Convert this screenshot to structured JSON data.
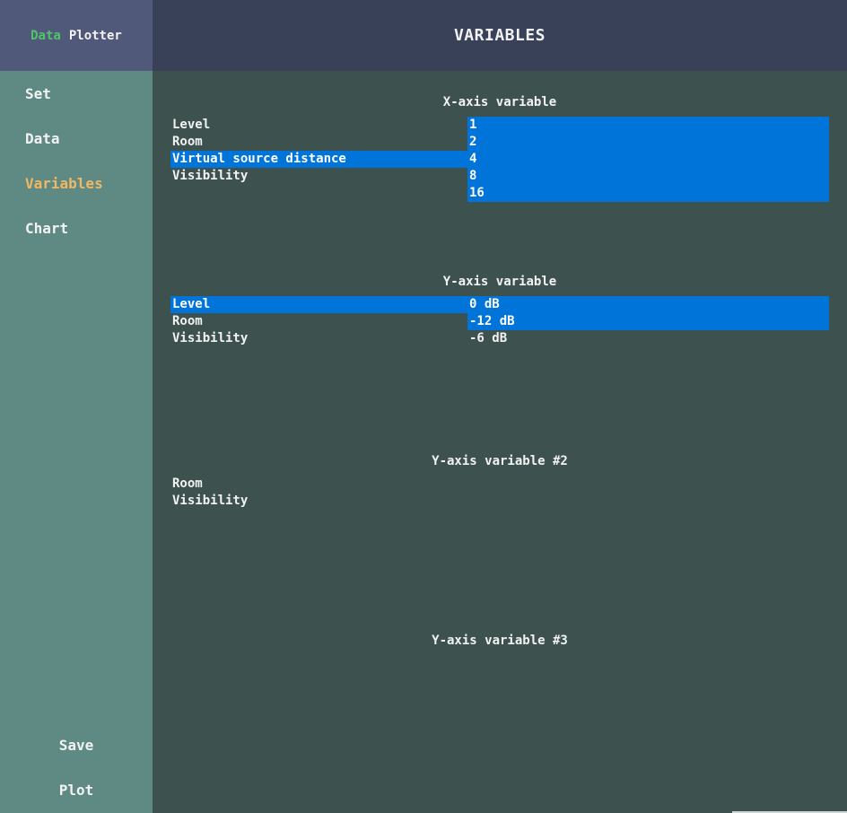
{
  "app": {
    "logo_word1": "Data",
    "logo_word2": "Plotter",
    "header_title": "VARIABLES"
  },
  "sidebar": {
    "items": [
      {
        "label": "Set",
        "active": false
      },
      {
        "label": "Data",
        "active": false
      },
      {
        "label": "Variables",
        "active": true
      },
      {
        "label": "Chart",
        "active": false
      }
    ],
    "save_label": "Save",
    "plot_label": "Plot"
  },
  "x_axis": {
    "title": "X-axis variable",
    "variables": [
      {
        "label": "Level",
        "selected": false
      },
      {
        "label": "Room",
        "selected": false
      },
      {
        "label": "Virtual source distance",
        "selected": true
      },
      {
        "label": "Visibility",
        "selected": false
      }
    ],
    "values": [
      {
        "label": "1",
        "selected": true
      },
      {
        "label": "2",
        "selected": true
      },
      {
        "label": "4",
        "selected": true
      },
      {
        "label": "8",
        "selected": true
      },
      {
        "label": "16",
        "selected": true
      }
    ]
  },
  "y_axis": {
    "title": "Y-axis variable",
    "variables": [
      {
        "label": "Level",
        "selected": true
      },
      {
        "label": "Room",
        "selected": false
      },
      {
        "label": "Visibility",
        "selected": false
      }
    ],
    "values": [
      {
        "label": "0 dB",
        "selected": true
      },
      {
        "label": "-12 dB",
        "selected": true
      },
      {
        "label": "-6 dB",
        "selected": false
      }
    ]
  },
  "y_axis_2": {
    "title": "Y-axis variable #2",
    "variables": [
      {
        "label": "Room",
        "selected": false
      },
      {
        "label": "Visibility",
        "selected": false
      }
    ]
  },
  "y_axis_3": {
    "title": "Y-axis variable #3"
  },
  "colors": {
    "selection": "#0074d9",
    "active_nav": "#f0b865",
    "logo_accent": "#4fc46a"
  }
}
